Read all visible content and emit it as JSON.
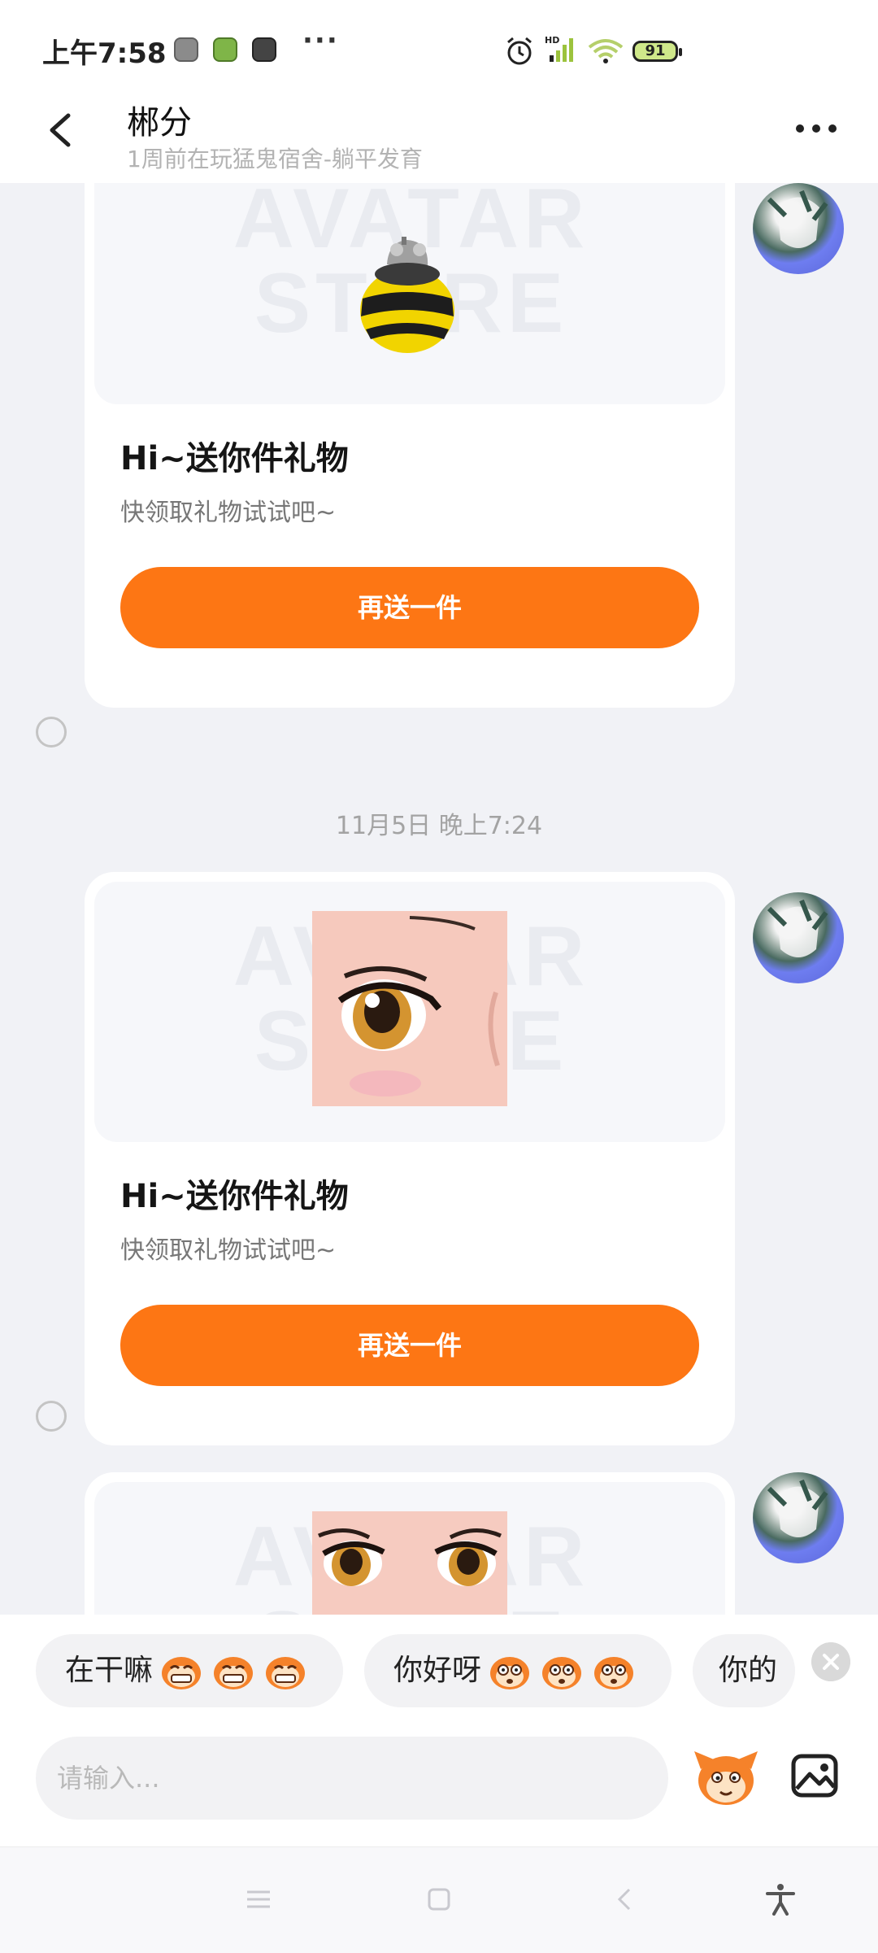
{
  "status_bar": {
    "time": "上午7:58",
    "more": "···",
    "battery": "91",
    "network": "HD"
  },
  "header": {
    "title": "郴分",
    "subtitle": "1周前在玩猛鬼宿舍-躺平发育"
  },
  "messages": [
    {
      "image": "bee-gift",
      "watermark_line1": "AVATAR",
      "watermark_line2": "STORE",
      "title": "Hi~送你件礼物",
      "desc": "快领取礼物试试吧~",
      "button": "再送一件"
    },
    {
      "timestamp": "11月5日 晚上7:24",
      "image": "anime-eye-gift",
      "watermark_line1": "AVATAR",
      "watermark_line2": "STORE",
      "title": "Hi~送你件礼物",
      "desc": "快领取礼物试试吧~",
      "button": "再送一件"
    },
    {
      "image": "anime-eyes-gift",
      "watermark_line1": "AVATAR",
      "watermark_line2": "STORE"
    }
  ],
  "quick_replies": [
    {
      "text": "在干嘛",
      "emoji": "grin-monkey"
    },
    {
      "text": "你好呀",
      "emoji": "wide-eye-monkey"
    },
    {
      "text": "你的"
    }
  ],
  "input": {
    "placeholder": "请输入..."
  },
  "colors": {
    "accent": "#fd7614",
    "background": "#f1f2f6"
  }
}
